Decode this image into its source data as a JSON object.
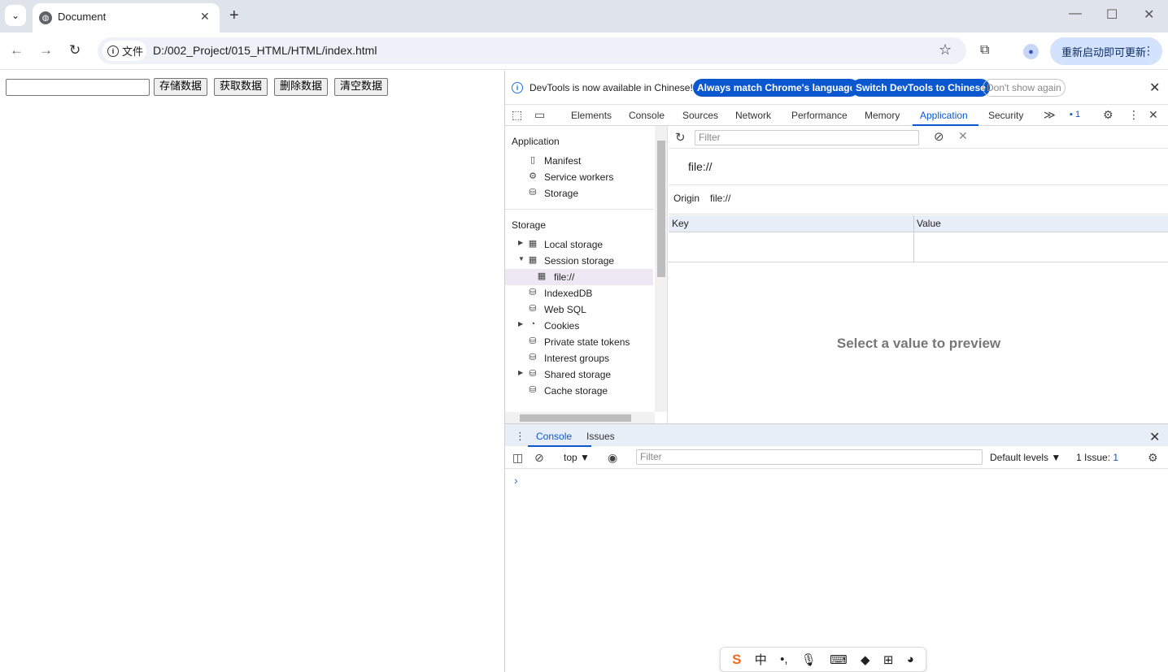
{
  "browser": {
    "tab_title": "Document",
    "address": {
      "chip": "文件",
      "url": "D:/002_Project/015_HTML/HTML/index.html"
    },
    "relaunch_label": "重新启动即可更新"
  },
  "page": {
    "buttons": [
      "存储数据",
      "获取数据",
      "删除数据",
      "清空数据"
    ],
    "input_value": ""
  },
  "devtools": {
    "infobar": {
      "message": "DevTools is now available in Chinese!",
      "btn_match": "Always match Chrome's language",
      "btn_switch": "Switch DevTools to Chinese",
      "btn_dismiss": "Don't show again"
    },
    "tabs": [
      "Elements",
      "Console",
      "Sources",
      "Network",
      "Performance",
      "Memory",
      "Application",
      "Security"
    ],
    "active_tab": "Application",
    "issues_badge": "1",
    "sidebar": {
      "app_header": "Application",
      "app_items": [
        "Manifest",
        "Service workers",
        "Storage"
      ],
      "storage_header": "Storage",
      "storage_items": [
        "Local storage",
        "Session storage",
        "file://",
        "IndexedDB",
        "Web SQL",
        "Cookies",
        "Private state tokens",
        "Interest groups",
        "Shared storage",
        "Cache storage"
      ]
    },
    "main": {
      "filter_placeholder": "Filter",
      "origin_title": "file://",
      "origin_label": "Origin",
      "origin_value": "file://",
      "col_key": "Key",
      "col_value": "Value",
      "preview_text": "Select a value to preview"
    },
    "drawer": {
      "tabs": [
        "Console",
        "Issues"
      ],
      "context": "top",
      "filter_placeholder": "Filter",
      "levels": "Default levels",
      "issues_label": "1 Issue:",
      "issues_count": "1"
    }
  },
  "ime": {
    "logo": "S",
    "mode": "中"
  },
  "colors": {
    "accent": "#0b57d0",
    "tabstrip": "#dfe3eb",
    "selection": "#ede8f3"
  }
}
